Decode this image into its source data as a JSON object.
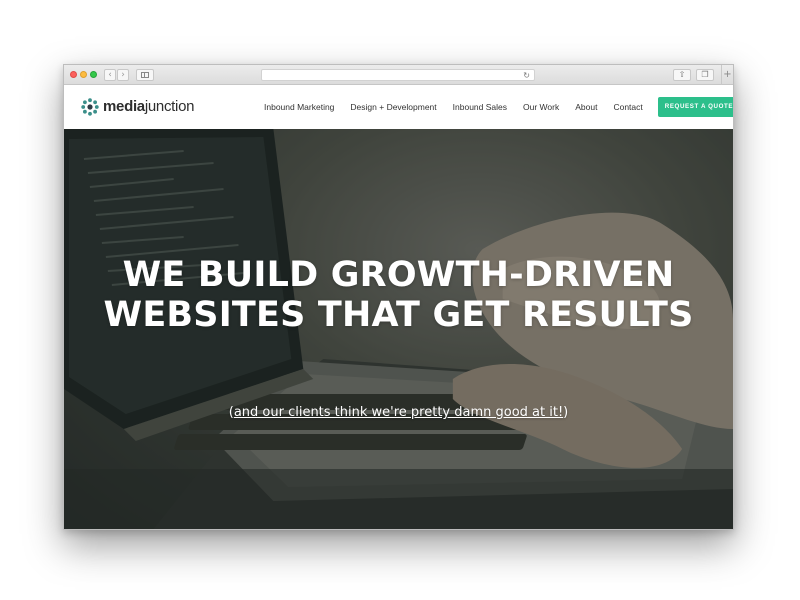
{
  "browser": {
    "back_icon": "‹",
    "forward_icon": "›",
    "reload_icon": "↻",
    "share_icon": "⇧",
    "tabs_icon": "❐",
    "new_tab_icon": "+"
  },
  "site": {
    "logo": {
      "bold": "media",
      "regular": "junction",
      "accent_color": "#3b8f8a"
    },
    "nav": [
      {
        "label": "Inbound Marketing"
      },
      {
        "label": "Design + Development"
      },
      {
        "label": "Inbound Sales"
      },
      {
        "label": "Our Work"
      },
      {
        "label": "About"
      },
      {
        "label": "Contact"
      }
    ],
    "cta": {
      "label": "REQUEST A QUOTE",
      "color": "#2cbf8b"
    }
  },
  "hero": {
    "title_line1": "WE BUILD GROWTH-DRIVEN",
    "title_line2": "WEBSITES THAT GET RESULTS",
    "subtitle_open": "(",
    "subtitle_link": "and our clients think we're pretty damn good at it!",
    "subtitle_close": ")"
  }
}
